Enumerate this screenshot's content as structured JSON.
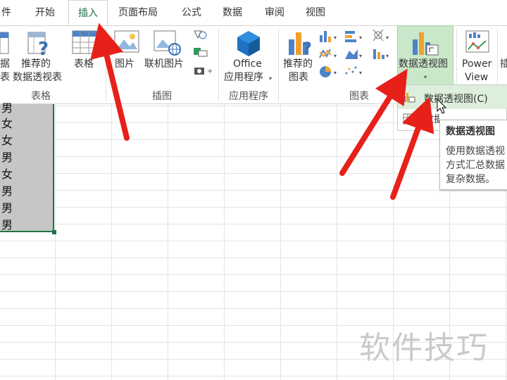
{
  "tabs": [
    "件",
    "开始",
    "插入",
    "页面布局",
    "公式",
    "数据",
    "审阅",
    "视图"
  ],
  "ribbon": {
    "partial_left": [
      "据",
      "表"
    ],
    "recommended_pivot": [
      "推荐的",
      "数据透视表"
    ],
    "table": "表格",
    "group_tables": "表格",
    "picture": "图片",
    "online_picture": "联机图片",
    "group_illustrations": "插图",
    "office": [
      "Office",
      "应用程序"
    ],
    "group_apps": "应用程序",
    "recommended_charts": [
      "推荐的",
      "图表"
    ],
    "group_charts": "图表",
    "pivot_chart": "数据透视图",
    "power_view": [
      "Power",
      "View"
    ],
    "partial_right": "插"
  },
  "cells": [
    "男",
    "女",
    "女",
    "男",
    "女",
    "男",
    "男",
    "男"
  ],
  "dropdown": {
    "item1": "数据透视图(C)",
    "item2": "数据透视图和数据"
  },
  "tooltip": {
    "title": "数据透视图",
    "lines": [
      "使用数据透视",
      "方式汇总数据",
      "复杂数据。"
    ]
  },
  "watermark": "软件技巧",
  "colors": {
    "accent": "#217346",
    "arrow": "#e8201a",
    "selection": "#c6c6c6",
    "hover": "#dcefdc"
  }
}
